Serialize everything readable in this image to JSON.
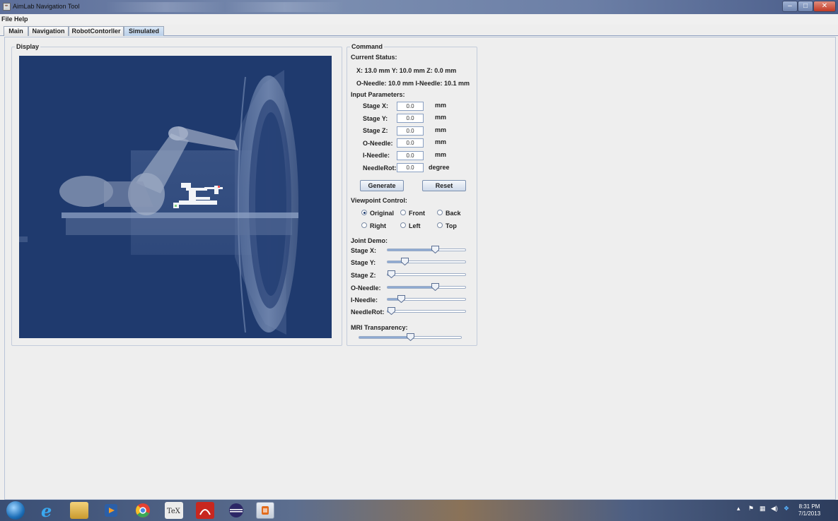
{
  "window": {
    "title": "AimLab Navigation Tool"
  },
  "menu": [
    "File",
    "Help"
  ],
  "tabs": [
    {
      "label": "Main",
      "active": false
    },
    {
      "label": "Navigation",
      "active": false
    },
    {
      "label": "RobotContorller",
      "active": false
    },
    {
      "label": "Simulated",
      "active": true
    }
  ],
  "display": {
    "title": "Display",
    "background_color": "#1f3a6e"
  },
  "command": {
    "title": "Command",
    "status_heading": "Current Status:",
    "status_line1": "X: 13.0 mm   Y: 10.0 mm   Z: 0.0 mm",
    "status_line2": "O-Needle: 10.0 mm   I-Needle: 10.1 mm",
    "params_heading": "Input Parameters:",
    "params": [
      {
        "label": "Stage X:",
        "value": "0.0",
        "unit": "mm"
      },
      {
        "label": "Stage Y:",
        "value": "0.0",
        "unit": "mm"
      },
      {
        "label": "Stage Z:",
        "value": "0.0",
        "unit": "mm"
      },
      {
        "label": "O-Needle:",
        "value": "0.0",
        "unit": "mm"
      },
      {
        "label": "I-Needle:",
        "value": "0.0",
        "unit": "mm"
      },
      {
        "label": "NeedleRot:",
        "value": "0.0",
        "unit": "degree"
      }
    ],
    "generate_label": "Generate",
    "reset_label": "Reset",
    "viewpoint_heading": "Viewpoint Control:",
    "viewpoints": [
      {
        "label": "Original",
        "selected": true
      },
      {
        "label": "Front",
        "selected": false
      },
      {
        "label": "Back",
        "selected": false
      },
      {
        "label": "Right",
        "selected": false
      },
      {
        "label": "Left",
        "selected": false
      },
      {
        "label": "Top",
        "selected": false
      }
    ],
    "joint_heading": "Joint Demo:",
    "joints": [
      {
        "label": "Stage X:",
        "fraction": 0.63
      },
      {
        "label": "Stage Y:",
        "fraction": 0.19
      },
      {
        "label": "Stage Z:",
        "fraction": 0.0
      },
      {
        "label": "O-Needle:",
        "fraction": 0.63
      },
      {
        "label": "I-Needle:",
        "fraction": 0.14
      },
      {
        "label": "NeedleRot:",
        "fraction": 0.0
      }
    ],
    "mri_heading": "MRI Transparency:",
    "mri_fraction": 0.5
  },
  "taskbar": {
    "time": "8:31 PM",
    "date": "7/1/2013",
    "apps": [
      "start-orb",
      "internet-explorer",
      "file-explorer",
      "media-player",
      "chrome",
      "tex",
      "acrobat",
      "eclipse",
      "java"
    ]
  }
}
